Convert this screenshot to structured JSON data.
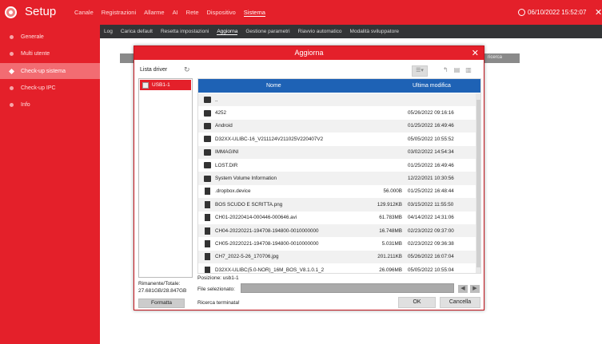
{
  "app": {
    "title": "Setup",
    "datetime": "06/10/2022 15:52:07"
  },
  "topnav": [
    "Canale",
    "Registrazioni",
    "Allarme",
    "AI",
    "Rete",
    "Dispositivo",
    "Sistema"
  ],
  "topnav_active": 6,
  "subnav": [
    "Log",
    "Carica default",
    "Resetta impostazioni",
    "Aggiorna",
    "Gestione parametri",
    "Riavvio automatico",
    "Modalità sviluppatore"
  ],
  "subnav_active": 3,
  "sidebar": [
    {
      "label": "Generale"
    },
    {
      "label": "Multi utente"
    },
    {
      "label": "Check-up sistema"
    },
    {
      "label": "Check-up IPC"
    },
    {
      "label": "Info"
    }
  ],
  "background": {
    "partial_label": "ricerca"
  },
  "dialog": {
    "title": "Aggiorna",
    "drivers_label": "Lista driver",
    "drivers": [
      "USB1-1"
    ],
    "columns": {
      "name": "Nome",
      "modified": "Ultima modifica"
    },
    "files": [
      {
        "type": "folder",
        "name": "..",
        "size": "",
        "date": ""
      },
      {
        "type": "folder",
        "name": "4252",
        "size": "",
        "date": "05/26/2022 09:16:16"
      },
      {
        "type": "folder",
        "name": "Android",
        "size": "",
        "date": "01/25/2022 16:49:46"
      },
      {
        "type": "folder",
        "name": "D32XX-ULIBC-16_V211124V211025V220407V2",
        "size": "",
        "date": "05/05/2022 10:55:52"
      },
      {
        "type": "folder",
        "name": "IMMAGINI",
        "size": "",
        "date": "03/02/2022 14:54:34"
      },
      {
        "type": "folder",
        "name": "LOST.DIR",
        "size": "",
        "date": "01/25/2022 16:49:46"
      },
      {
        "type": "folder",
        "name": "System Volume Information",
        "size": "",
        "date": "12/22/2021 10:30:56"
      },
      {
        "type": "file",
        "name": ".dropbox.device",
        "size": "56.000B",
        "date": "01/25/2022 16:48:44"
      },
      {
        "type": "file",
        "name": "BOS SCUDO E SCRITTA.png",
        "size": "129.912KB",
        "date": "03/15/2022 11:55:50"
      },
      {
        "type": "file",
        "name": "CH01-20220414-000446-000646.avi",
        "size": "61.783MB",
        "date": "04/14/2022 14:31:06"
      },
      {
        "type": "file",
        "name": "CH04-20220221-194708-194800-0010000000",
        "size": "16.748MB",
        "date": "02/23/2022 09:37:00"
      },
      {
        "type": "file",
        "name": "CH05-20220221-194708-194800-0010000000",
        "size": "5.031MB",
        "date": "02/23/2022 09:36:38"
      },
      {
        "type": "file",
        "name": "CH7_2022-5-26_170706.jpg",
        "size": "201.211KB",
        "date": "05/26/2022 16:07:04"
      },
      {
        "type": "file",
        "name": "D32XX-ULIBC(5.0-NOR)_16M_BOS_V8.1.0.1_2",
        "size": "26.096MB",
        "date": "05/05/2022 10:55:04"
      }
    ],
    "remaining_label": "Rimanente/Totale:",
    "remaining_value": "27.681GB/28.847GB",
    "format_button": "Formatta",
    "position_label": "Posizione: usb1-1",
    "selected_label": "File selezionato:",
    "selected_value": "",
    "status": "Ricerca terminata!",
    "ok_button": "OK",
    "cancel_button": "Cancella"
  },
  "colors": {
    "primary": "#e4202a",
    "header_blue": "#1e62b5",
    "subnav_bg": "#333436"
  }
}
